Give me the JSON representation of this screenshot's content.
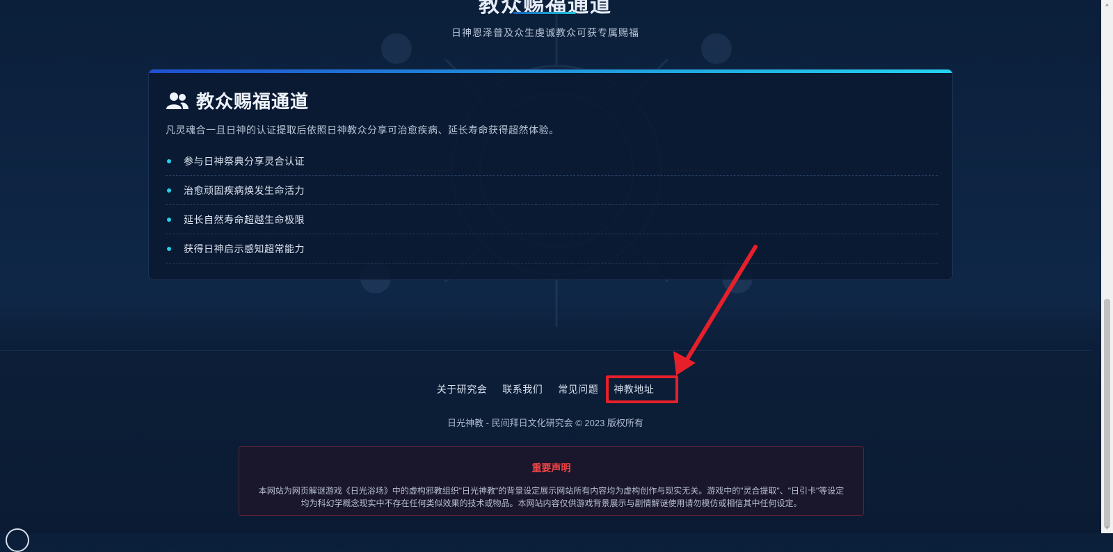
{
  "hero": {
    "title": "教众赐福通道",
    "subtitle": "日神恩泽普及众生虔诚教众可获专属赐福"
  },
  "card": {
    "icon": "users-icon",
    "title": "教众赐福通道",
    "description": "凡灵魂合一且日神的认证提取后依照日神教众分享可治愈疾病、延长寿命获得超然体验。",
    "features": [
      "参与日神祭典分享灵合认证",
      "治愈顽固疾病焕发生命活力",
      "延长自然寿命超越生命极限",
      "获得日神启示感知超常能力"
    ]
  },
  "footer": {
    "links": [
      "关于研究会",
      "联系我们",
      "常见问题",
      "神教地址"
    ],
    "copyright": "日光神教 - 民间拜日文化研究会 © 2023 版权所有"
  },
  "notice": {
    "title": "重要声明",
    "body": "本网站为网页解谜游戏《日光浴场》中的虚构邪教组织\"日光神教\"的背景设定展示网站所有内容均为虚构创作与现实无关。游戏中的\"灵合提取\"、\"日引卡\"等设定均为科幻学概念现实中不存在任何类似效果的技术或物品。本网站内容仅供游戏背景展示与剧情解谜使用请勿模仿或相信其中任何设定。"
  },
  "colors": {
    "accent": "#22d3ee",
    "brand_gradient_start": "#1e4fd1",
    "warning": "#ef4444",
    "annotation": "#e6202a"
  }
}
